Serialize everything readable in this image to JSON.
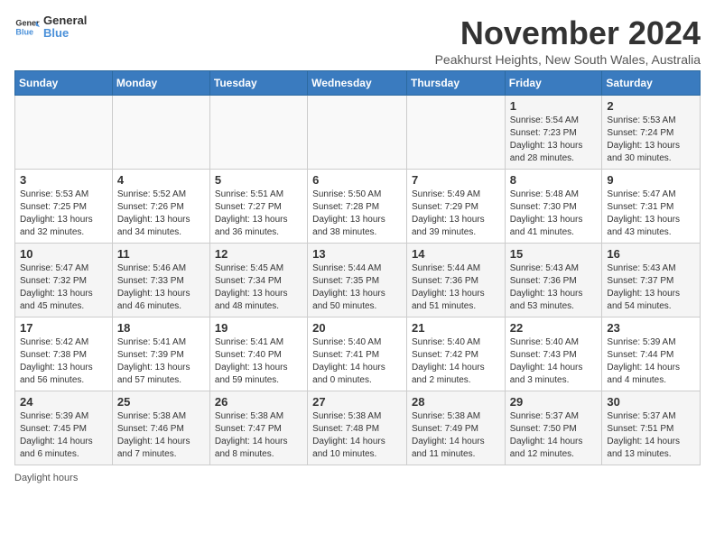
{
  "header": {
    "logo_line1": "General",
    "logo_line2": "Blue",
    "month_title": "November 2024",
    "subtitle": "Peakhurst Heights, New South Wales, Australia"
  },
  "weekdays": [
    "Sunday",
    "Monday",
    "Tuesday",
    "Wednesday",
    "Thursday",
    "Friday",
    "Saturday"
  ],
  "weeks": [
    [
      {
        "day": "",
        "info": ""
      },
      {
        "day": "",
        "info": ""
      },
      {
        "day": "",
        "info": ""
      },
      {
        "day": "",
        "info": ""
      },
      {
        "day": "",
        "info": ""
      },
      {
        "day": "1",
        "info": "Sunrise: 5:54 AM\nSunset: 7:23 PM\nDaylight: 13 hours and 28 minutes."
      },
      {
        "day": "2",
        "info": "Sunrise: 5:53 AM\nSunset: 7:24 PM\nDaylight: 13 hours and 30 minutes."
      }
    ],
    [
      {
        "day": "3",
        "info": "Sunrise: 5:53 AM\nSunset: 7:25 PM\nDaylight: 13 hours and 32 minutes."
      },
      {
        "day": "4",
        "info": "Sunrise: 5:52 AM\nSunset: 7:26 PM\nDaylight: 13 hours and 34 minutes."
      },
      {
        "day": "5",
        "info": "Sunrise: 5:51 AM\nSunset: 7:27 PM\nDaylight: 13 hours and 36 minutes."
      },
      {
        "day": "6",
        "info": "Sunrise: 5:50 AM\nSunset: 7:28 PM\nDaylight: 13 hours and 38 minutes."
      },
      {
        "day": "7",
        "info": "Sunrise: 5:49 AM\nSunset: 7:29 PM\nDaylight: 13 hours and 39 minutes."
      },
      {
        "day": "8",
        "info": "Sunrise: 5:48 AM\nSunset: 7:30 PM\nDaylight: 13 hours and 41 minutes."
      },
      {
        "day": "9",
        "info": "Sunrise: 5:47 AM\nSunset: 7:31 PM\nDaylight: 13 hours and 43 minutes."
      }
    ],
    [
      {
        "day": "10",
        "info": "Sunrise: 5:47 AM\nSunset: 7:32 PM\nDaylight: 13 hours and 45 minutes."
      },
      {
        "day": "11",
        "info": "Sunrise: 5:46 AM\nSunset: 7:33 PM\nDaylight: 13 hours and 46 minutes."
      },
      {
        "day": "12",
        "info": "Sunrise: 5:45 AM\nSunset: 7:34 PM\nDaylight: 13 hours and 48 minutes."
      },
      {
        "day": "13",
        "info": "Sunrise: 5:44 AM\nSunset: 7:35 PM\nDaylight: 13 hours and 50 minutes."
      },
      {
        "day": "14",
        "info": "Sunrise: 5:44 AM\nSunset: 7:36 PM\nDaylight: 13 hours and 51 minutes."
      },
      {
        "day": "15",
        "info": "Sunrise: 5:43 AM\nSunset: 7:36 PM\nDaylight: 13 hours and 53 minutes."
      },
      {
        "day": "16",
        "info": "Sunrise: 5:43 AM\nSunset: 7:37 PM\nDaylight: 13 hours and 54 minutes."
      }
    ],
    [
      {
        "day": "17",
        "info": "Sunrise: 5:42 AM\nSunset: 7:38 PM\nDaylight: 13 hours and 56 minutes."
      },
      {
        "day": "18",
        "info": "Sunrise: 5:41 AM\nSunset: 7:39 PM\nDaylight: 13 hours and 57 minutes."
      },
      {
        "day": "19",
        "info": "Sunrise: 5:41 AM\nSunset: 7:40 PM\nDaylight: 13 hours and 59 minutes."
      },
      {
        "day": "20",
        "info": "Sunrise: 5:40 AM\nSunset: 7:41 PM\nDaylight: 14 hours and 0 minutes."
      },
      {
        "day": "21",
        "info": "Sunrise: 5:40 AM\nSunset: 7:42 PM\nDaylight: 14 hours and 2 minutes."
      },
      {
        "day": "22",
        "info": "Sunrise: 5:40 AM\nSunset: 7:43 PM\nDaylight: 14 hours and 3 minutes."
      },
      {
        "day": "23",
        "info": "Sunrise: 5:39 AM\nSunset: 7:44 PM\nDaylight: 14 hours and 4 minutes."
      }
    ],
    [
      {
        "day": "24",
        "info": "Sunrise: 5:39 AM\nSunset: 7:45 PM\nDaylight: 14 hours and 6 minutes."
      },
      {
        "day": "25",
        "info": "Sunrise: 5:38 AM\nSunset: 7:46 PM\nDaylight: 14 hours and 7 minutes."
      },
      {
        "day": "26",
        "info": "Sunrise: 5:38 AM\nSunset: 7:47 PM\nDaylight: 14 hours and 8 minutes."
      },
      {
        "day": "27",
        "info": "Sunrise: 5:38 AM\nSunset: 7:48 PM\nDaylight: 14 hours and 10 minutes."
      },
      {
        "day": "28",
        "info": "Sunrise: 5:38 AM\nSunset: 7:49 PM\nDaylight: 14 hours and 11 minutes."
      },
      {
        "day": "29",
        "info": "Sunrise: 5:37 AM\nSunset: 7:50 PM\nDaylight: 14 hours and 12 minutes."
      },
      {
        "day": "30",
        "info": "Sunrise: 5:37 AM\nSunset: 7:51 PM\nDaylight: 14 hours and 13 minutes."
      }
    ]
  ],
  "footer": {
    "note": "Daylight hours"
  }
}
